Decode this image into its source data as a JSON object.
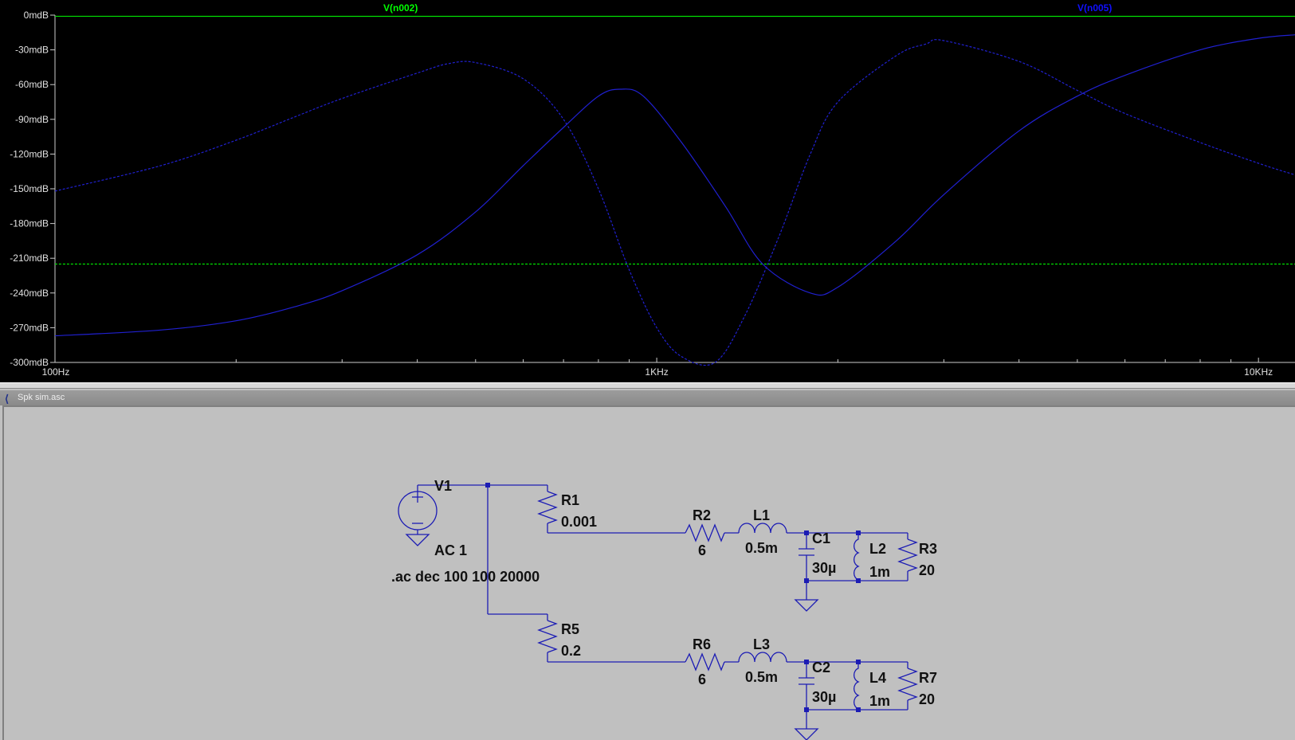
{
  "window": {
    "schematic_title": "Spk sim.asc",
    "app_icon": "ltspice-icon"
  },
  "plot": {
    "trace_labels": [
      {
        "text": "V(n002)",
        "color": "#00ff00"
      },
      {
        "text": "V(n005)",
        "color": "#0000ff"
      }
    ],
    "colors": {
      "background": "#000000",
      "green_trace": "#00e000",
      "blue_trace": "#2020d0",
      "axis": "#cccccc"
    }
  },
  "chart_data": {
    "type": "line",
    "xlabel": "",
    "ylabel": "",
    "x_scale": "log",
    "xlim": [
      100,
      11500
    ],
    "ylim": [
      -300,
      0
    ],
    "x_tick_labels": [
      "100Hz",
      "1KHz",
      "10KHz"
    ],
    "x_ticks": [
      100,
      1000,
      10000
    ],
    "y_tick_labels": [
      "0mdB",
      "-30mdB",
      "-60mdB",
      "-90mdB",
      "-120mdB",
      "-150mdB",
      "-180mdB",
      "-210mdB",
      "-240mdB",
      "-270mdB",
      "-300mdB"
    ],
    "y_ticks": [
      0,
      -30,
      -60,
      -90,
      -120,
      -150,
      -180,
      -210,
      -240,
      -270,
      -300
    ],
    "series": [
      {
        "name": "V(n002)",
        "style": "solid",
        "color": "#00e000",
        "x": [
          100,
          1000,
          11500
        ],
        "y": [
          -1,
          -1,
          -1
        ]
      },
      {
        "name": "V(n002)",
        "style": "dashed",
        "color": "#00e000",
        "x": [
          100,
          1000,
          11500
        ],
        "y": [
          -215,
          -215,
          -215
        ]
      },
      {
        "name": "V(n005)",
        "style": "solid",
        "color": "#2020d0",
        "x": [
          100,
          150,
          200,
          250,
          300,
          400,
          500,
          600,
          700,
          800,
          870,
          950,
          1100,
          1300,
          1500,
          1800,
          2000,
          2500,
          3000,
          4000,
          5000,
          6000,
          8000,
          10000,
          11500
        ],
        "y": [
          -277,
          -272,
          -264,
          -252,
          -238,
          -207,
          -170,
          -130,
          -97,
          -70,
          -64,
          -70,
          -110,
          -165,
          -215,
          -240,
          -235,
          -195,
          -155,
          -100,
          -70,
          -52,
          -30,
          -20,
          -17
        ]
      },
      {
        "name": "V(n005)",
        "style": "dashed",
        "color": "#2020d0",
        "x": [
          100,
          150,
          200,
          250,
          300,
          400,
          450,
          500,
          600,
          700,
          800,
          900,
          1000,
          1100,
          1250,
          1400,
          1600,
          1800,
          2000,
          2500,
          2800,
          3000,
          4000,
          5000,
          6000,
          8000,
          10000,
          11500
        ],
        "y": [
          -152,
          -130,
          -108,
          -88,
          -72,
          -50,
          -42,
          -41,
          -55,
          -90,
          -150,
          -220,
          -270,
          -295,
          -300,
          -260,
          -190,
          -120,
          -75,
          -35,
          -25,
          -22,
          -40,
          -65,
          -85,
          -110,
          -128,
          -138
        ]
      }
    ]
  },
  "schematic": {
    "parts": {
      "V1": "V1",
      "V1_value": "AC 1",
      "R1": "R1",
      "R1_value": "0.001",
      "R2": "R2",
      "R2_value": "6",
      "L1": "L1",
      "L1_value": "0.5m",
      "C1": "C1",
      "C1_value": "30µ",
      "L2": "L2",
      "L2_value": "1m",
      "R3": "R3",
      "R3_value": "20",
      "R5": "R5",
      "R5_value": "0.2",
      "R6": "R6",
      "R6_value": "6",
      "L3": "L3",
      "L3_value": "0.5m",
      "C2": "C2",
      "C2_value": "30µ",
      "L4": "L4",
      "L4_value": "1m",
      "R7": "R7",
      "R7_value": "20"
    },
    "directive": ".ac dec 100 100 20000"
  }
}
